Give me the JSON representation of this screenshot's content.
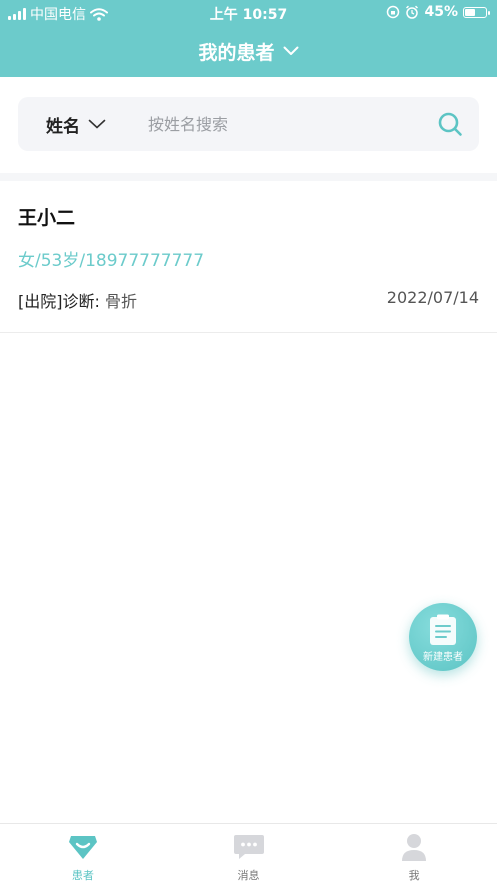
{
  "status_bar": {
    "carrier": "中国电信",
    "time": "上午 10:57",
    "battery_percent": "45%",
    "battery_level": 0.45
  },
  "header": {
    "title": "我的患者",
    "background_color": "#6ccbcb"
  },
  "search": {
    "field_label": "姓名",
    "placeholder": "按姓名搜索",
    "value": ""
  },
  "patients": [
    {
      "name": "王小二",
      "info": "女/53岁/18977777777",
      "diagnosis_label": "[出院]诊断:",
      "diagnosis_value": "骨折",
      "date": "2022/07/14"
    }
  ],
  "fab": {
    "label": "新建患者",
    "icon": "clipboard-icon"
  },
  "tabbar": {
    "active_color": "#5cc4c4",
    "items": [
      {
        "label": "患者",
        "icon": "patient-icon",
        "active": true
      },
      {
        "label": "消息",
        "icon": "message-icon",
        "active": false
      },
      {
        "label": "我",
        "icon": "user-icon",
        "active": false
      }
    ]
  }
}
